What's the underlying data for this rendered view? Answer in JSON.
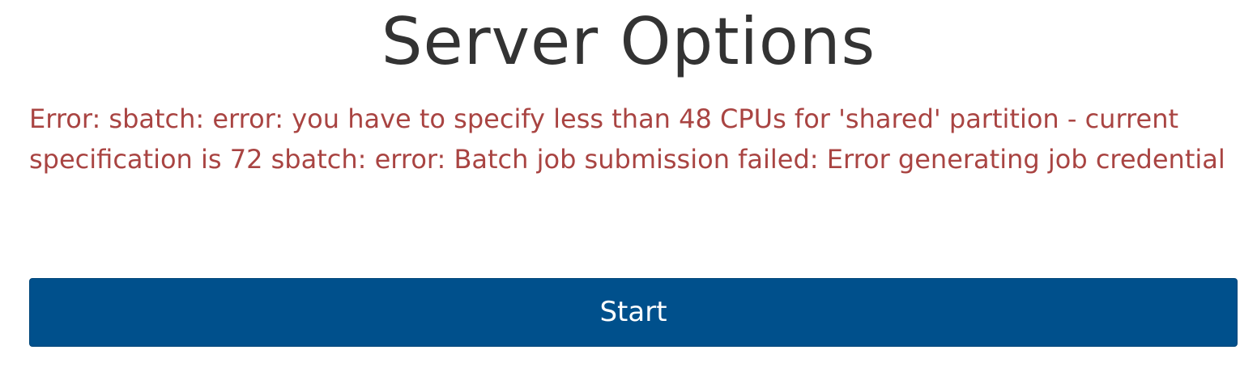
{
  "page": {
    "title": "Server Options"
  },
  "error": {
    "message": "Error: sbatch: error: you have to specify less than 48 CPUs for 'shared' partition - current specification is 72 sbatch: error: Batch job submission failed: Error generating job credential"
  },
  "actions": {
    "start_label": "Start"
  },
  "colors": {
    "error_text": "#a94442",
    "button_bg": "#00508c",
    "title_text": "#333333"
  }
}
